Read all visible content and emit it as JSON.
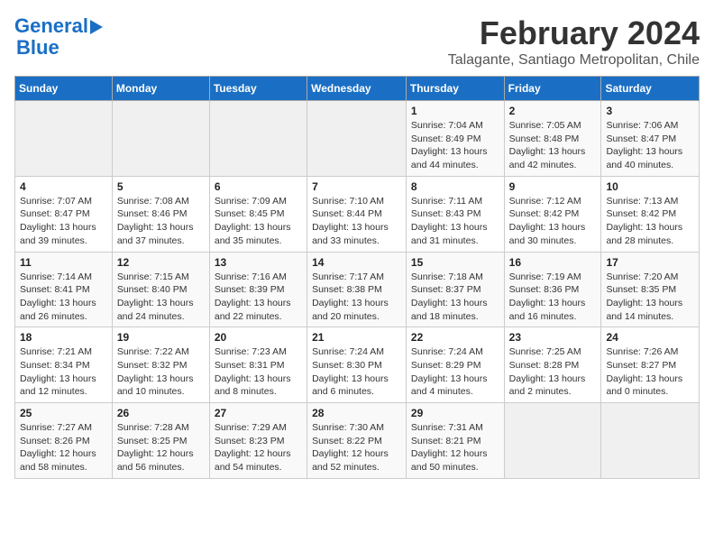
{
  "header": {
    "logo_line1": "General",
    "logo_line2": "Blue",
    "month": "February 2024",
    "location": "Talagante, Santiago Metropolitan, Chile"
  },
  "weekdays": [
    "Sunday",
    "Monday",
    "Tuesday",
    "Wednesday",
    "Thursday",
    "Friday",
    "Saturday"
  ],
  "weeks": [
    [
      {
        "day": "",
        "info": ""
      },
      {
        "day": "",
        "info": ""
      },
      {
        "day": "",
        "info": ""
      },
      {
        "day": "",
        "info": ""
      },
      {
        "day": "1",
        "info": "Sunrise: 7:04 AM\nSunset: 8:49 PM\nDaylight: 13 hours\nand 44 minutes."
      },
      {
        "day": "2",
        "info": "Sunrise: 7:05 AM\nSunset: 8:48 PM\nDaylight: 13 hours\nand 42 minutes."
      },
      {
        "day": "3",
        "info": "Sunrise: 7:06 AM\nSunset: 8:47 PM\nDaylight: 13 hours\nand 40 minutes."
      }
    ],
    [
      {
        "day": "4",
        "info": "Sunrise: 7:07 AM\nSunset: 8:47 PM\nDaylight: 13 hours\nand 39 minutes."
      },
      {
        "day": "5",
        "info": "Sunrise: 7:08 AM\nSunset: 8:46 PM\nDaylight: 13 hours\nand 37 minutes."
      },
      {
        "day": "6",
        "info": "Sunrise: 7:09 AM\nSunset: 8:45 PM\nDaylight: 13 hours\nand 35 minutes."
      },
      {
        "day": "7",
        "info": "Sunrise: 7:10 AM\nSunset: 8:44 PM\nDaylight: 13 hours\nand 33 minutes."
      },
      {
        "day": "8",
        "info": "Sunrise: 7:11 AM\nSunset: 8:43 PM\nDaylight: 13 hours\nand 31 minutes."
      },
      {
        "day": "9",
        "info": "Sunrise: 7:12 AM\nSunset: 8:42 PM\nDaylight: 13 hours\nand 30 minutes."
      },
      {
        "day": "10",
        "info": "Sunrise: 7:13 AM\nSunset: 8:42 PM\nDaylight: 13 hours\nand 28 minutes."
      }
    ],
    [
      {
        "day": "11",
        "info": "Sunrise: 7:14 AM\nSunset: 8:41 PM\nDaylight: 13 hours\nand 26 minutes."
      },
      {
        "day": "12",
        "info": "Sunrise: 7:15 AM\nSunset: 8:40 PM\nDaylight: 13 hours\nand 24 minutes."
      },
      {
        "day": "13",
        "info": "Sunrise: 7:16 AM\nSunset: 8:39 PM\nDaylight: 13 hours\nand 22 minutes."
      },
      {
        "day": "14",
        "info": "Sunrise: 7:17 AM\nSunset: 8:38 PM\nDaylight: 13 hours\nand 20 minutes."
      },
      {
        "day": "15",
        "info": "Sunrise: 7:18 AM\nSunset: 8:37 PM\nDaylight: 13 hours\nand 18 minutes."
      },
      {
        "day": "16",
        "info": "Sunrise: 7:19 AM\nSunset: 8:36 PM\nDaylight: 13 hours\nand 16 minutes."
      },
      {
        "day": "17",
        "info": "Sunrise: 7:20 AM\nSunset: 8:35 PM\nDaylight: 13 hours\nand 14 minutes."
      }
    ],
    [
      {
        "day": "18",
        "info": "Sunrise: 7:21 AM\nSunset: 8:34 PM\nDaylight: 13 hours\nand 12 minutes."
      },
      {
        "day": "19",
        "info": "Sunrise: 7:22 AM\nSunset: 8:32 PM\nDaylight: 13 hours\nand 10 minutes."
      },
      {
        "day": "20",
        "info": "Sunrise: 7:23 AM\nSunset: 8:31 PM\nDaylight: 13 hours\nand 8 minutes."
      },
      {
        "day": "21",
        "info": "Sunrise: 7:24 AM\nSunset: 8:30 PM\nDaylight: 13 hours\nand 6 minutes."
      },
      {
        "day": "22",
        "info": "Sunrise: 7:24 AM\nSunset: 8:29 PM\nDaylight: 13 hours\nand 4 minutes."
      },
      {
        "day": "23",
        "info": "Sunrise: 7:25 AM\nSunset: 8:28 PM\nDaylight: 13 hours\nand 2 minutes."
      },
      {
        "day": "24",
        "info": "Sunrise: 7:26 AM\nSunset: 8:27 PM\nDaylight: 13 hours\nand 0 minutes."
      }
    ],
    [
      {
        "day": "25",
        "info": "Sunrise: 7:27 AM\nSunset: 8:26 PM\nDaylight: 12 hours\nand 58 minutes."
      },
      {
        "day": "26",
        "info": "Sunrise: 7:28 AM\nSunset: 8:25 PM\nDaylight: 12 hours\nand 56 minutes."
      },
      {
        "day": "27",
        "info": "Sunrise: 7:29 AM\nSunset: 8:23 PM\nDaylight: 12 hours\nand 54 minutes."
      },
      {
        "day": "28",
        "info": "Sunrise: 7:30 AM\nSunset: 8:22 PM\nDaylight: 12 hours\nand 52 minutes."
      },
      {
        "day": "29",
        "info": "Sunrise: 7:31 AM\nSunset: 8:21 PM\nDaylight: 12 hours\nand 50 minutes."
      },
      {
        "day": "",
        "info": ""
      },
      {
        "day": "",
        "info": ""
      }
    ]
  ]
}
